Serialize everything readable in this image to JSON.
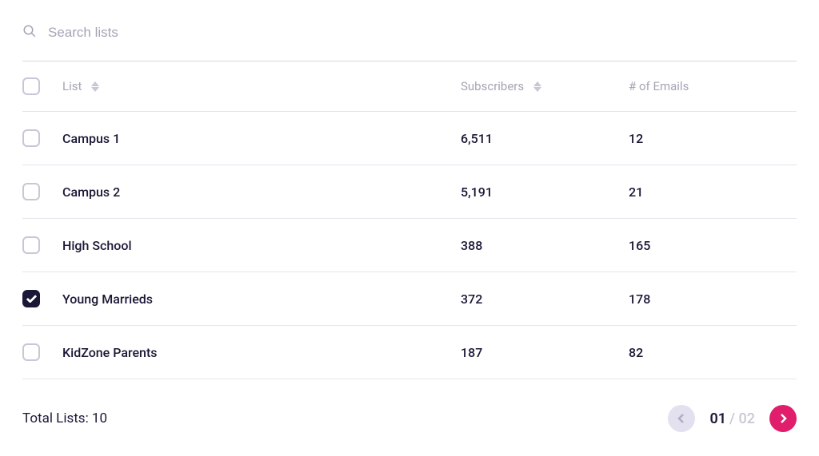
{
  "search": {
    "placeholder": "Search lists"
  },
  "headers": {
    "list": "List",
    "subscribers": "Subscribers",
    "emails": "# of Emails"
  },
  "rows": [
    {
      "name": "Campus 1",
      "subscribers": "6,511",
      "emails": "12",
      "checked": false
    },
    {
      "name": "Campus 2",
      "subscribers": "5,191",
      "emails": "21",
      "checked": false
    },
    {
      "name": "High School",
      "subscribers": "388",
      "emails": "165",
      "checked": false
    },
    {
      "name": "Young Marrieds",
      "subscribers": "372",
      "emails": "178",
      "checked": true
    },
    {
      "name": "KidZone Parents",
      "subscribers": "187",
      "emails": "82",
      "checked": false
    }
  ],
  "footer": {
    "total_label": "Total Lists: 10",
    "current_page": "01",
    "total_pages": "02"
  }
}
